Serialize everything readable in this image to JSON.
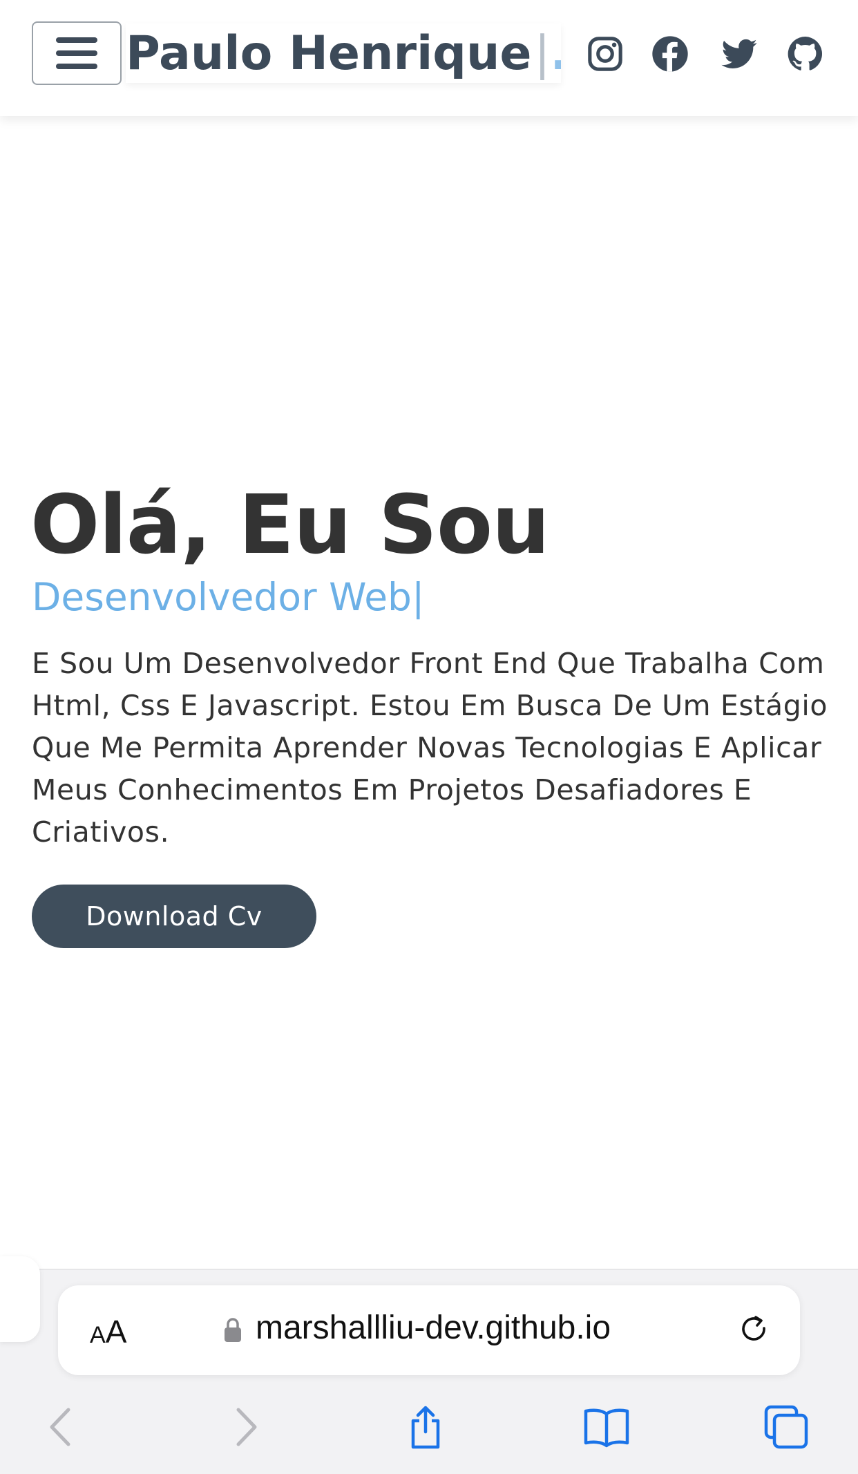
{
  "header": {
    "brand_name": "Paulo Henrique",
    "brand_cursor": "|",
    "brand_dot": ".",
    "social_icons": [
      "instagram-icon",
      "facebook-icon",
      "twitter-icon",
      "github-icon"
    ]
  },
  "hero": {
    "title": "Olá, Eu Sou",
    "subtitle": "Desenvolvedor Web|",
    "description": "E Sou Um Desenvolvedor Front End Que Trabalha Com Html, Css E Javascript. Estou Em Busca De Um Estágio Que Me Permita Aprender Novas Tecnologias E Aplicar Meus Conhecimentos Em Projetos Desafiadores E Criativos.",
    "cv_button": "Download Cv"
  },
  "browser": {
    "aa_small": "A",
    "aa_big": "A",
    "url": "marshallliu-dev.github.io"
  },
  "colors": {
    "brand": "#3c4a59",
    "accent": "#6cb0e6",
    "button": "#3f4e5c",
    "safari_blue": "#1a73e8"
  }
}
